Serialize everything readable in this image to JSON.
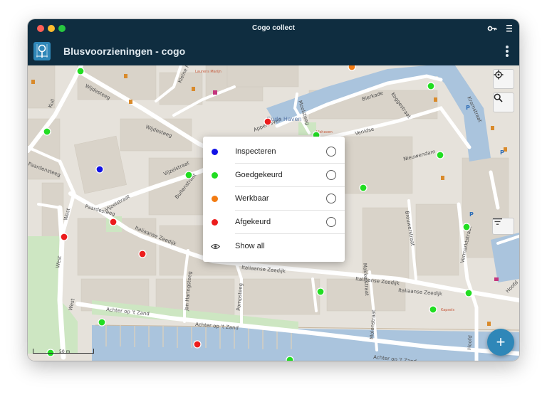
{
  "window": {
    "title": "Cogo collect"
  },
  "appbar": {
    "title": "Blusvoorzieningen - cogo"
  },
  "map": {
    "streets": [
      "Wijdesteeg",
      "Kuil",
      "Paardensteeg",
      "Wijdesteeg",
      "Vijzelstraat",
      "Paardesteeg",
      "West",
      "West",
      "West",
      "Vijzelstraat",
      "Buitenstraat",
      "Appelhaven",
      "Gude Haven",
      "Venidse",
      "Nieuwendam",
      "Bierkade",
      "Koggestraat",
      "Kromstraat",
      "Kleine Havensteeg",
      "Moolsteeg",
      "Italiaanse Zeedijk",
      "Italiaanse Zeedijk",
      "Italiaanse Zeedijk",
      "Achter op 't Zand",
      "Achter op 't Zand",
      "Achter op 't Zand",
      "Jan Haringsteeg",
      "Pompsteeg",
      "Molenstraat",
      "Makkerstraat",
      "Vermarktstraat",
      "Hoofd",
      "Hoofd",
      "Brouwerstraat",
      "Italiaanse Zeedijk"
    ],
    "scale_label": "50 m",
    "poi_labels": [
      "Laurens Marijn",
      "Vishaven",
      "Kapsels"
    ]
  },
  "filter_menu": {
    "items": [
      {
        "label": "Inspecteren",
        "color": "#1212e6"
      },
      {
        "label": "Goedgekeurd",
        "color": "#22dd22"
      },
      {
        "label": "Werkbaar",
        "color": "#f27b12"
      },
      {
        "label": "Afgekeurd",
        "color": "#ec1c1c"
      }
    ],
    "show_all_label": "Show all"
  },
  "marker_colors": {
    "blue": "#1212e6",
    "green": "#22dd22",
    "orange": "#f27b12",
    "red": "#ec1c1c"
  },
  "icons": [
    "key-icon",
    "hamburger-icon",
    "more-vert-icon",
    "locate-icon",
    "search-icon",
    "filter-icon",
    "add-icon",
    "eye-icon"
  ],
  "accent_color": "#2f87b8"
}
